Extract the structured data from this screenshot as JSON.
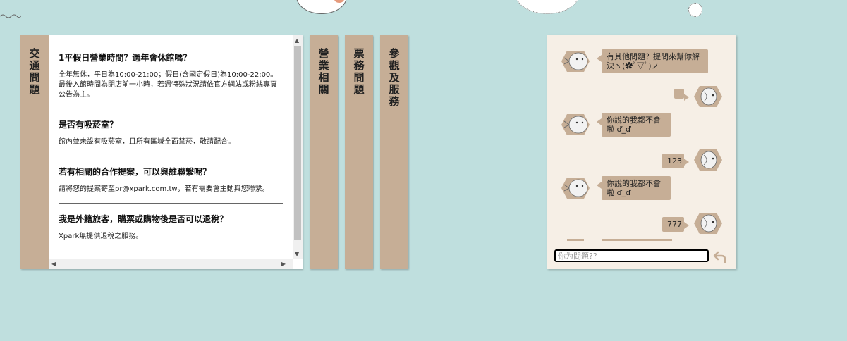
{
  "faq": {
    "active_tab": "交通問題",
    "tabs": [
      {
        "id": "traffic",
        "label": "交通問題"
      },
      {
        "id": "business",
        "label": "營業相關"
      },
      {
        "id": "tickets",
        "label": "票務問題"
      },
      {
        "id": "visit",
        "label": "參觀及服務"
      }
    ],
    "items": [
      {
        "q": "1平假日營業時間？過年會休館嗎？",
        "a": "全年無休，平日為10:00-21:00；假日(含國定假日)為10:00-22:00。最後入館時間為閉店前一小時，若遇特殊狀況請依官方網站或粉絲專頁公告為主。"
      },
      {
        "q": "是否有吸菸室？",
        "a": "館內並未設有吸菸室，且所有區域全面禁菸，敬請配合。"
      },
      {
        "q": "若有相關的合作提案，可以與誰聯繫呢？",
        "a": "請將您的提案寄至pr@xpark.com.tw，若有需要會主動與您聯繫。"
      },
      {
        "q": "我是外籍旅客，購票或購物後是否可以退稅？",
        "a": "Xpark無提供退稅之服務。"
      }
    ]
  },
  "chat": {
    "messages": [
      {
        "from": "bot",
        "text": "有其他問題？提問來幫你解決ヽ(✿ﾟ▽ﾟ)ノ"
      },
      {
        "from": "user",
        "text": ""
      },
      {
        "from": "bot",
        "text": "你說的我都不會啦 ď_ď"
      },
      {
        "from": "user",
        "text": "123"
      },
      {
        "from": "bot",
        "text": "你說的我都不會啦 ď_ď"
      },
      {
        "from": "user",
        "text": "777"
      }
    ],
    "input_placeholder": "你为問題??",
    "input_value": ""
  },
  "colors": {
    "background": "#bfdfde",
    "tab": "#c6ae96",
    "chat_bg": "#f6efe6"
  }
}
